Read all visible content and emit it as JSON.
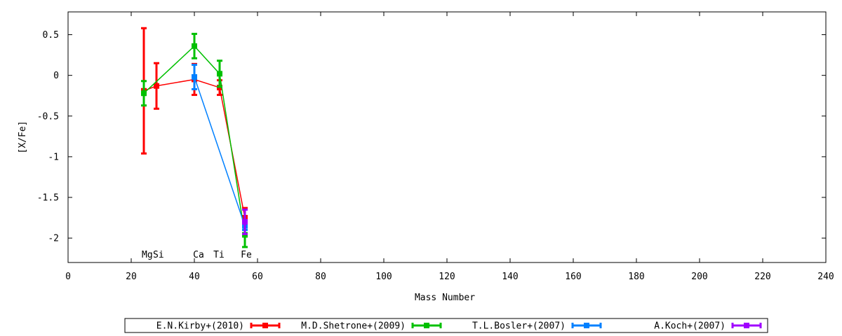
{
  "chart_data": {
    "type": "line",
    "xlabel": "Mass Number",
    "ylabel": "[X/Fe]",
    "xlim": [
      0,
      240
    ],
    "ylim": [
      -2.3,
      0.78
    ],
    "x_ticks": [
      0,
      20,
      40,
      60,
      80,
      100,
      120,
      140,
      160,
      180,
      200,
      220,
      240
    ],
    "y_ticks": [
      0.5,
      0,
      -0.5,
      -1,
      -1.5,
      -2
    ],
    "y_tick_labels": [
      "0.5",
      "0",
      "-0.5",
      "-1",
      "-1.5",
      "-2"
    ],
    "grid": false,
    "legend_position": "bottom",
    "element_labels": [
      {
        "text": "Mg",
        "x": 24
      },
      {
        "text": "Si",
        "x": 28
      },
      {
        "text": "Ca",
        "x": 40
      },
      {
        "text": "Ti",
        "x": 48
      },
      {
        "text": "Fe",
        "x": 56
      }
    ],
    "series": [
      {
        "name": "E.N.Kirby+(2010)",
        "color": "#ff0000",
        "points": [
          {
            "x": 24,
            "y": -0.19,
            "err": 0.77
          },
          {
            "x": 28,
            "y": -0.13,
            "err": 0.28
          },
          {
            "x": 40,
            "y": -0.05,
            "err": 0.19
          },
          {
            "x": 48,
            "y": -0.15,
            "err": 0.09
          },
          {
            "x": 56,
            "y": -1.75,
            "err": 0.12
          }
        ]
      },
      {
        "name": "M.D.Shetrone+(2009)",
        "color": "#00c000",
        "points": [
          {
            "x": 24,
            "y": -0.22,
            "err": 0.15
          },
          {
            "x": 40,
            "y": 0.36,
            "err": 0.15
          },
          {
            "x": 48,
            "y": 0.02,
            "err": 0.16
          },
          {
            "x": 56,
            "y": -1.96,
            "err": 0.15
          }
        ]
      },
      {
        "name": "T.L.Bosler+(2007)",
        "color": "#0080ff",
        "points": [
          {
            "x": 40,
            "y": -0.02,
            "err": 0.15
          },
          {
            "x": 56,
            "y": -1.85,
            "err": 0.05
          }
        ]
      },
      {
        "name": "A.Koch+(2007)",
        "color": "#a000ff",
        "points": [
          {
            "x": 56,
            "y": -1.8,
            "err": 0.15
          }
        ]
      }
    ]
  }
}
